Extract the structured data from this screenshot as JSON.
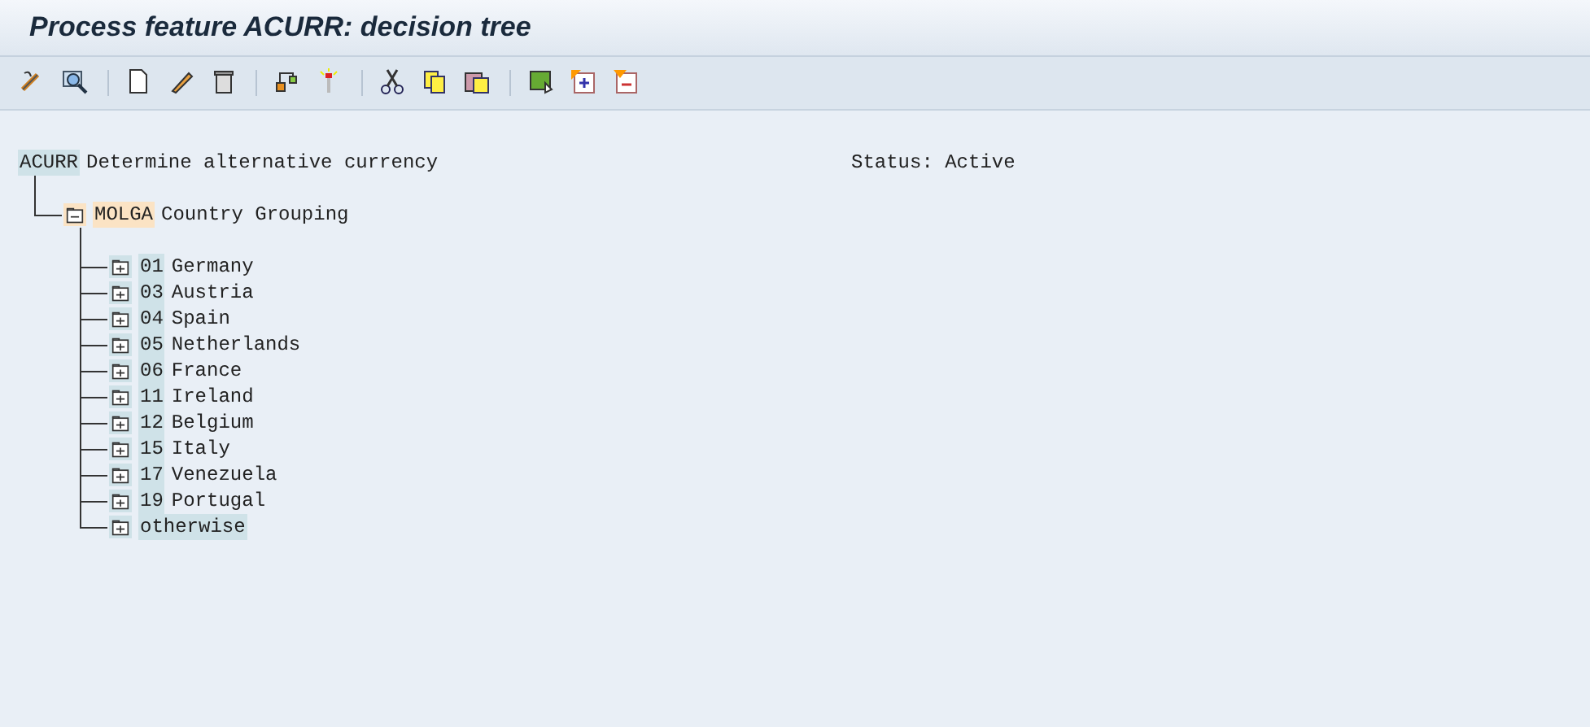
{
  "window": {
    "title": "Process feature ACURR: decision tree"
  },
  "tree": {
    "code": "ACURR",
    "text": "Determine alternative currency",
    "status": "Status: Active",
    "children": [
      {
        "code": "MOLGA",
        "text": "Country Grouping",
        "expanded": true,
        "children": [
          {
            "code": "01",
            "text": "Germany",
            "expanded": false
          },
          {
            "code": "03",
            "text": "Austria",
            "expanded": false
          },
          {
            "code": "04",
            "text": "Spain",
            "expanded": false
          },
          {
            "code": "05",
            "text": "Netherlands",
            "expanded": false
          },
          {
            "code": "06",
            "text": "France",
            "expanded": false
          },
          {
            "code": "11",
            "text": "Ireland",
            "expanded": false
          },
          {
            "code": "12",
            "text": "Belgium",
            "expanded": false
          },
          {
            "code": "15",
            "text": "Italy",
            "expanded": false
          },
          {
            "code": "17",
            "text": "Venezuela",
            "expanded": false
          },
          {
            "code": "19",
            "text": "Portugal",
            "expanded": false
          },
          {
            "code": "otherwise",
            "expanded": false
          }
        ]
      }
    ]
  }
}
